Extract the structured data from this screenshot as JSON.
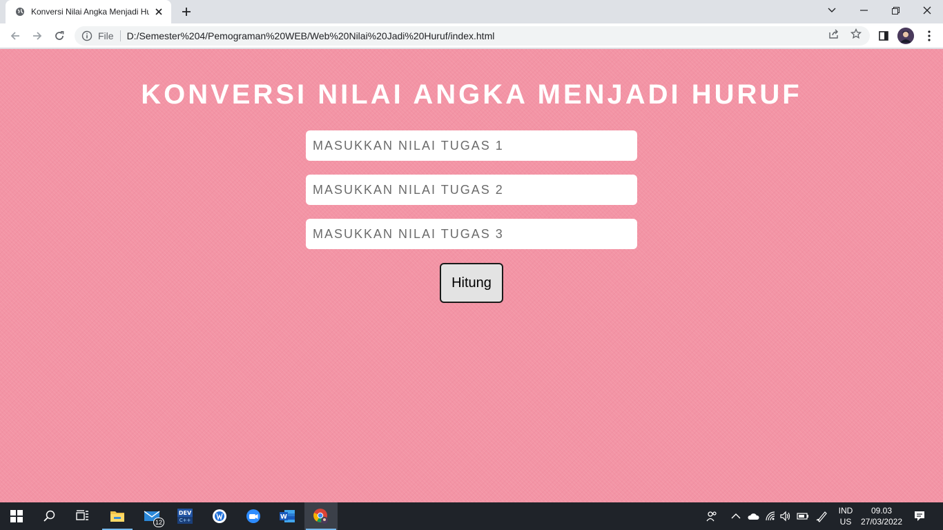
{
  "browser": {
    "tab_title": "Konversi Nilai Angka Menjadi Hu",
    "site_info_label": "File",
    "url": "D:/Semester%204/Pemograman%20WEB/Web%20Nilai%20Jadi%20Huruf/index.html"
  },
  "page": {
    "title": "KONVERSI NILAI ANGKA MENJADI HURUF",
    "inputs": [
      {
        "placeholder": "MASUKKAN NILAI TUGAS 1",
        "value": ""
      },
      {
        "placeholder": "MASUKKAN NILAI TUGAS 2",
        "value": ""
      },
      {
        "placeholder": "MASUKKAN NILAI TUGAS 3",
        "value": ""
      }
    ],
    "button_label": "Hitung",
    "background_color": "#f394a5"
  },
  "taskbar": {
    "mail_badge": "12",
    "devcpp_label": "DEV C++",
    "language_top": "IND",
    "language_bottom": "US",
    "time": "09.03",
    "date": "27/03/2022"
  },
  "icons": [
    "globe-icon",
    "close-icon",
    "plus-icon",
    "chevron-down-icon",
    "minimize-icon",
    "restore-icon",
    "back-icon",
    "forward-icon",
    "reload-icon",
    "info-icon",
    "share-icon",
    "star-icon",
    "sidepanel-icon",
    "avatar",
    "menu-icon",
    "windows-icon",
    "search-icon",
    "task-view-icon",
    "file-explorer-icon",
    "mail-icon",
    "devcpp-icon",
    "app-icon",
    "zoom-icon",
    "word-icon",
    "chrome-icon",
    "people-icon",
    "chevron-up-icon",
    "cloud-icon",
    "wifi-icon",
    "volume-icon",
    "battery-icon",
    "pen-icon",
    "notification-icon"
  ]
}
